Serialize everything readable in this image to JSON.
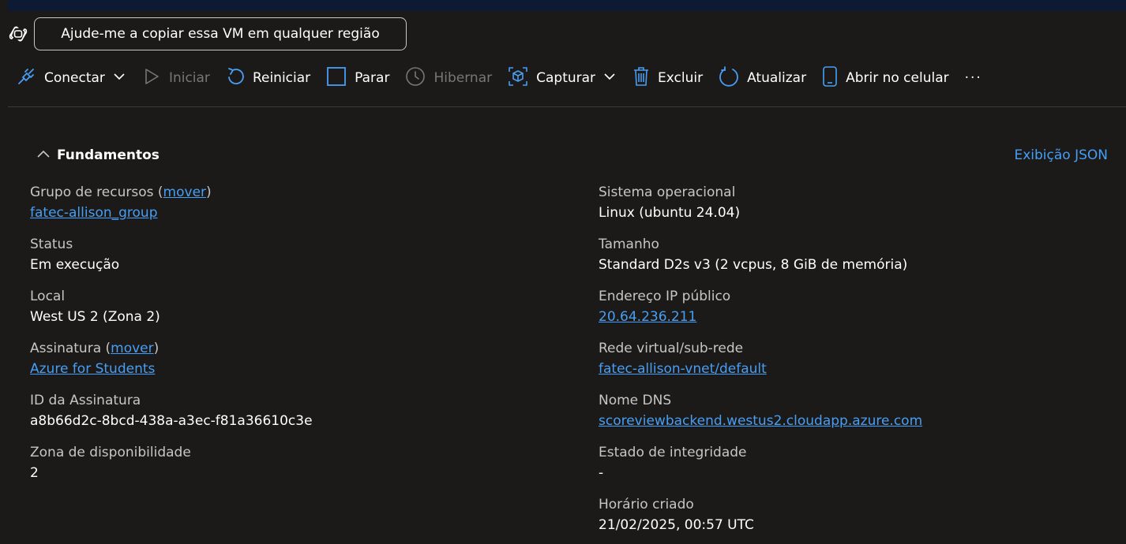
{
  "copilot": {
    "icon": "copilot-icon",
    "prompt": "Ajude-me a copiar essa VM em qualquer região"
  },
  "toolbar": {
    "items": [
      {
        "label": "Conectar",
        "icon": "plug-icon",
        "dropdown": true,
        "disabled": false
      },
      {
        "label": "Iniciar",
        "icon": "play-icon",
        "dropdown": false,
        "disabled": true
      },
      {
        "label": "Reiniciar",
        "icon": "restart-icon",
        "dropdown": false,
        "disabled": false
      },
      {
        "label": "Parar",
        "icon": "stop-icon",
        "dropdown": false,
        "disabled": false
      },
      {
        "label": "Hibernar",
        "icon": "clock-icon",
        "dropdown": false,
        "disabled": true
      },
      {
        "label": "Capturar",
        "icon": "cube-icon",
        "dropdown": true,
        "disabled": false
      },
      {
        "label": "Excluir",
        "icon": "trash-icon",
        "dropdown": false,
        "disabled": false
      },
      {
        "label": "Atualizar",
        "icon": "refresh-icon",
        "dropdown": false,
        "disabled": false
      },
      {
        "label": "Abrir no celular",
        "icon": "phone-icon",
        "dropdown": false,
        "disabled": false
      }
    ],
    "more": "···"
  },
  "essentials": {
    "title": "Fundamentos",
    "json_view": "Exibição JSON",
    "left": {
      "resource_group_label": "Grupo de recursos",
      "move": "mover",
      "resource_group_value": "fatec-allison_group",
      "status_label": "Status",
      "status_value": "Em execução",
      "location_label": "Local",
      "location_value": "West US 2 (Zona 2)",
      "subscription_label": "Assinatura",
      "subscription_value": "Azure for Students",
      "subscription_id_label": "ID da Assinatura",
      "subscription_id_value": "a8b66d2c-8bcd-438a-a3ec-f81a36610c3e",
      "zone_label": "Zona de disponibilidade",
      "zone_value": "2"
    },
    "right": {
      "os_label": "Sistema operacional",
      "os_value": "Linux (ubuntu 24.04)",
      "size_label": "Tamanho",
      "size_value": "Standard D2s v3 (2 vcpus, 8 GiB de memória)",
      "ip_label": "Endereço IP público",
      "ip_value": "20.64.236.211",
      "vnet_label": "Rede virtual/sub-rede",
      "vnet_value": "fatec-allison-vnet/default",
      "dns_label": "Nome DNS",
      "dns_value": "scoreviewbackend.westus2.cloudapp.azure.com",
      "health_label": "Estado de integridade",
      "health_value": "-",
      "created_label": "Horário criado",
      "created_value": "21/02/2025, 00:57 UTC"
    }
  },
  "colors": {
    "background": "#1b1a19",
    "link": "#479ef5",
    "icon_accent": "#479ef5",
    "disabled": "#797775"
  }
}
